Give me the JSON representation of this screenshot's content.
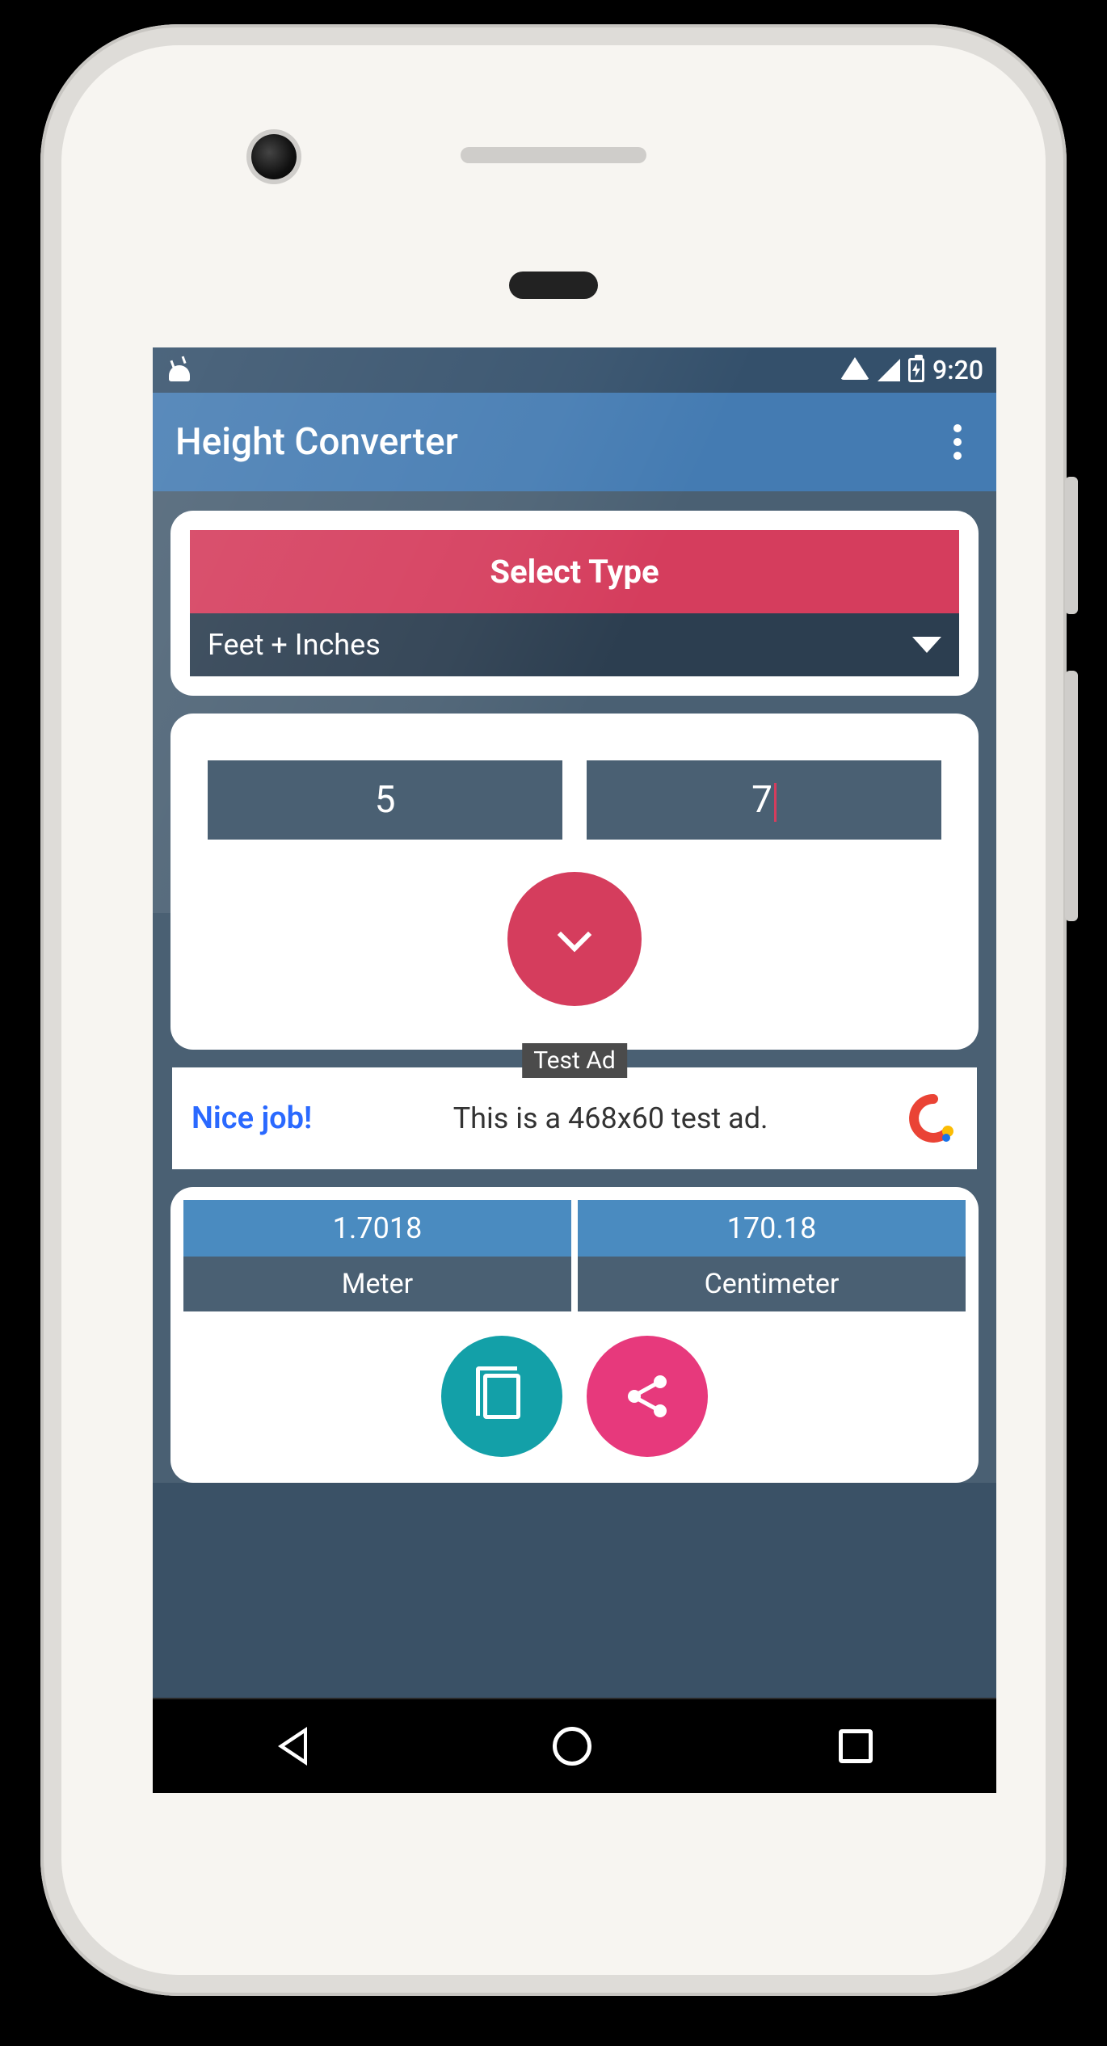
{
  "statusbar": {
    "time": "9:20"
  },
  "appbar": {
    "title": "Height Converter"
  },
  "select": {
    "header": "Select Type",
    "value": "Feet + Inches"
  },
  "inputs": {
    "feet": "5",
    "inches": "7"
  },
  "ad": {
    "tag": "Test Ad",
    "left": "Nice job!",
    "text": "This is a 468x60 test ad."
  },
  "results": {
    "meter_value": "1.7018",
    "meter_label": "Meter",
    "cm_value": "170.18",
    "cm_label": "Centimeter"
  },
  "colors": {
    "accent_pink": "#d53d5d",
    "appbar_blue": "#447bb2",
    "panel_dark": "#2c3e50",
    "panel_slate": "#4a6073",
    "teal": "#13a0a8",
    "magenta": "#e7397c"
  }
}
